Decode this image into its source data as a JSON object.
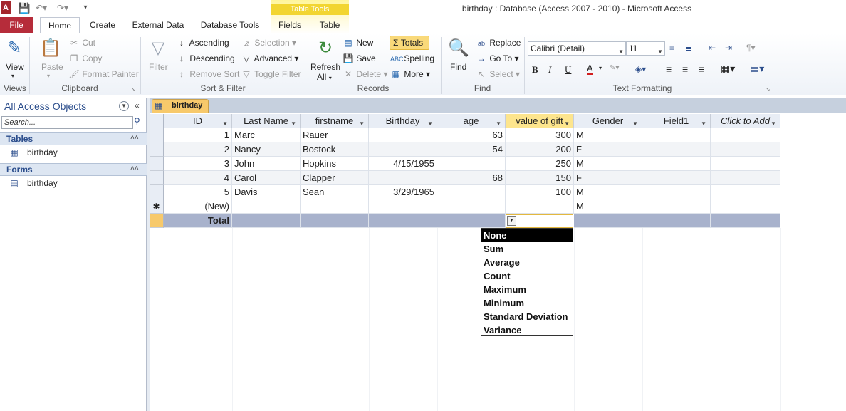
{
  "window": {
    "title": "birthday : Database (Access 2007 - 2010)  -  Microsoft Access",
    "app_icon": "A",
    "contextual_group": "Table Tools"
  },
  "tabs": {
    "file": "File",
    "home": "Home",
    "create": "Create",
    "external": "External Data",
    "dbtools": "Database Tools",
    "fields": "Fields",
    "table": "Table"
  },
  "ribbon": {
    "views": {
      "label": "Views",
      "view": "View"
    },
    "clipboard": {
      "label": "Clipboard",
      "paste": "Paste",
      "cut": "Cut",
      "copy": "Copy",
      "format_painter": "Format Painter"
    },
    "sort_filter": {
      "label": "Sort & Filter",
      "filter": "Filter",
      "ascending": "Ascending",
      "descending": "Descending",
      "remove_sort": "Remove Sort",
      "selection": "Selection",
      "advanced": "Advanced",
      "toggle_filter": "Toggle Filter"
    },
    "records": {
      "label": "Records",
      "refresh": "Refresh",
      "refresh_all": "All",
      "new": "New",
      "save": "Save",
      "delete": "Delete",
      "totals": "Totals",
      "spelling": "Spelling",
      "more": "More"
    },
    "find": {
      "label": "Find",
      "find": "Find",
      "replace": "Replace",
      "goto": "Go To",
      "select": "Select"
    },
    "text_formatting": {
      "label": "Text Formatting",
      "font": "Calibri (Detail)",
      "size": "11",
      "bold": "B",
      "italic": "I",
      "underline": "U",
      "font_color": "A"
    }
  },
  "nav": {
    "title": "All Access Objects",
    "search_placeholder": "Search...",
    "groups": [
      {
        "label": "Tables",
        "items": [
          "birthday"
        ]
      },
      {
        "label": "Forms",
        "items": [
          "birthday"
        ]
      }
    ]
  },
  "document": {
    "tab_label": "birthday",
    "columns": [
      "ID",
      "Last Name",
      "firstname",
      "Birthday",
      "age",
      "value of gift",
      "Gender",
      "Field1",
      "Click to Add"
    ],
    "rows": [
      [
        "1",
        "Marc",
        "Rauer",
        "",
        "63",
        "300",
        "M",
        "",
        ""
      ],
      [
        "2",
        "Nancy",
        "Bostock",
        "",
        "54",
        "200",
        "F",
        "",
        ""
      ],
      [
        "3",
        "John",
        "Hopkins",
        "4/15/1955",
        "",
        "250",
        "M",
        "",
        ""
      ],
      [
        "4",
        "Carol",
        "Clapper",
        "",
        "68",
        "150",
        "F",
        "",
        ""
      ],
      [
        "5",
        "Davis",
        "Sean",
        "3/29/1965",
        "",
        "100",
        "M",
        "",
        ""
      ]
    ],
    "new_row": {
      "id": "(New)",
      "gender": "M",
      "marker": "✱"
    },
    "total_label": "Total",
    "totals_menu": [
      "None",
      "Sum",
      "Average",
      "Count",
      "Maximum",
      "Minimum",
      "Standard Deviation",
      "Variance"
    ]
  }
}
